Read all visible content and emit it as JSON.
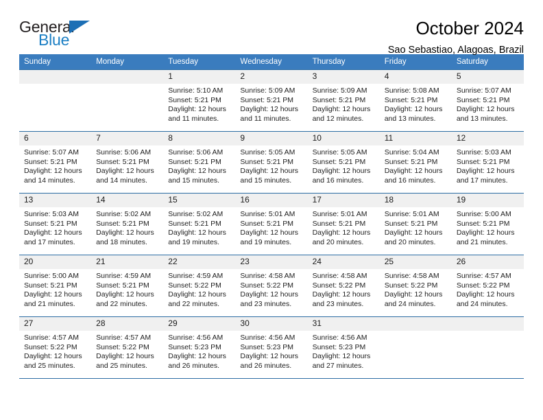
{
  "brand": {
    "name_top": "General",
    "name_bottom": "Blue",
    "accent_color": "#1c7fc4",
    "triangle_color": "#1c6fb5"
  },
  "header": {
    "title": "October 2024",
    "subtitle": "Sao Sebastiao, Alagoas, Brazil"
  },
  "theme": {
    "header_row_bg": "#3a7cbe",
    "header_row_text": "#ffffff",
    "daynum_bg": "#f0f0f0",
    "row_border": "#2b6ca3"
  },
  "weekday_headers": [
    "Sunday",
    "Monday",
    "Tuesday",
    "Wednesday",
    "Thursday",
    "Friday",
    "Saturday"
  ],
  "labels": {
    "sunrise_prefix": "Sunrise:",
    "sunset_prefix": "Sunset:",
    "daylight_prefix": "Daylight:"
  },
  "weeks": [
    [
      {
        "day": "",
        "sunrise": "",
        "sunset": "",
        "daylight_1": "",
        "daylight_2": ""
      },
      {
        "day": "",
        "sunrise": "",
        "sunset": "",
        "daylight_1": "",
        "daylight_2": ""
      },
      {
        "day": "1",
        "sunrise": "Sunrise: 5:10 AM",
        "sunset": "Sunset: 5:21 PM",
        "daylight_1": "Daylight: 12 hours",
        "daylight_2": "and 11 minutes."
      },
      {
        "day": "2",
        "sunrise": "Sunrise: 5:09 AM",
        "sunset": "Sunset: 5:21 PM",
        "daylight_1": "Daylight: 12 hours",
        "daylight_2": "and 11 minutes."
      },
      {
        "day": "3",
        "sunrise": "Sunrise: 5:09 AM",
        "sunset": "Sunset: 5:21 PM",
        "daylight_1": "Daylight: 12 hours",
        "daylight_2": "and 12 minutes."
      },
      {
        "day": "4",
        "sunrise": "Sunrise: 5:08 AM",
        "sunset": "Sunset: 5:21 PM",
        "daylight_1": "Daylight: 12 hours",
        "daylight_2": "and 13 minutes."
      },
      {
        "day": "5",
        "sunrise": "Sunrise: 5:07 AM",
        "sunset": "Sunset: 5:21 PM",
        "daylight_1": "Daylight: 12 hours",
        "daylight_2": "and 13 minutes."
      }
    ],
    [
      {
        "day": "6",
        "sunrise": "Sunrise: 5:07 AM",
        "sunset": "Sunset: 5:21 PM",
        "daylight_1": "Daylight: 12 hours",
        "daylight_2": "and 14 minutes."
      },
      {
        "day": "7",
        "sunrise": "Sunrise: 5:06 AM",
        "sunset": "Sunset: 5:21 PM",
        "daylight_1": "Daylight: 12 hours",
        "daylight_2": "and 14 minutes."
      },
      {
        "day": "8",
        "sunrise": "Sunrise: 5:06 AM",
        "sunset": "Sunset: 5:21 PM",
        "daylight_1": "Daylight: 12 hours",
        "daylight_2": "and 15 minutes."
      },
      {
        "day": "9",
        "sunrise": "Sunrise: 5:05 AM",
        "sunset": "Sunset: 5:21 PM",
        "daylight_1": "Daylight: 12 hours",
        "daylight_2": "and 15 minutes."
      },
      {
        "day": "10",
        "sunrise": "Sunrise: 5:05 AM",
        "sunset": "Sunset: 5:21 PM",
        "daylight_1": "Daylight: 12 hours",
        "daylight_2": "and 16 minutes."
      },
      {
        "day": "11",
        "sunrise": "Sunrise: 5:04 AM",
        "sunset": "Sunset: 5:21 PM",
        "daylight_1": "Daylight: 12 hours",
        "daylight_2": "and 16 minutes."
      },
      {
        "day": "12",
        "sunrise": "Sunrise: 5:03 AM",
        "sunset": "Sunset: 5:21 PM",
        "daylight_1": "Daylight: 12 hours",
        "daylight_2": "and 17 minutes."
      }
    ],
    [
      {
        "day": "13",
        "sunrise": "Sunrise: 5:03 AM",
        "sunset": "Sunset: 5:21 PM",
        "daylight_1": "Daylight: 12 hours",
        "daylight_2": "and 17 minutes."
      },
      {
        "day": "14",
        "sunrise": "Sunrise: 5:02 AM",
        "sunset": "Sunset: 5:21 PM",
        "daylight_1": "Daylight: 12 hours",
        "daylight_2": "and 18 minutes."
      },
      {
        "day": "15",
        "sunrise": "Sunrise: 5:02 AM",
        "sunset": "Sunset: 5:21 PM",
        "daylight_1": "Daylight: 12 hours",
        "daylight_2": "and 19 minutes."
      },
      {
        "day": "16",
        "sunrise": "Sunrise: 5:01 AM",
        "sunset": "Sunset: 5:21 PM",
        "daylight_1": "Daylight: 12 hours",
        "daylight_2": "and 19 minutes."
      },
      {
        "day": "17",
        "sunrise": "Sunrise: 5:01 AM",
        "sunset": "Sunset: 5:21 PM",
        "daylight_1": "Daylight: 12 hours",
        "daylight_2": "and 20 minutes."
      },
      {
        "day": "18",
        "sunrise": "Sunrise: 5:01 AM",
        "sunset": "Sunset: 5:21 PM",
        "daylight_1": "Daylight: 12 hours",
        "daylight_2": "and 20 minutes."
      },
      {
        "day": "19",
        "sunrise": "Sunrise: 5:00 AM",
        "sunset": "Sunset: 5:21 PM",
        "daylight_1": "Daylight: 12 hours",
        "daylight_2": "and 21 minutes."
      }
    ],
    [
      {
        "day": "20",
        "sunrise": "Sunrise: 5:00 AM",
        "sunset": "Sunset: 5:21 PM",
        "daylight_1": "Daylight: 12 hours",
        "daylight_2": "and 21 minutes."
      },
      {
        "day": "21",
        "sunrise": "Sunrise: 4:59 AM",
        "sunset": "Sunset: 5:21 PM",
        "daylight_1": "Daylight: 12 hours",
        "daylight_2": "and 22 minutes."
      },
      {
        "day": "22",
        "sunrise": "Sunrise: 4:59 AM",
        "sunset": "Sunset: 5:22 PM",
        "daylight_1": "Daylight: 12 hours",
        "daylight_2": "and 22 minutes."
      },
      {
        "day": "23",
        "sunrise": "Sunrise: 4:58 AM",
        "sunset": "Sunset: 5:22 PM",
        "daylight_1": "Daylight: 12 hours",
        "daylight_2": "and 23 minutes."
      },
      {
        "day": "24",
        "sunrise": "Sunrise: 4:58 AM",
        "sunset": "Sunset: 5:22 PM",
        "daylight_1": "Daylight: 12 hours",
        "daylight_2": "and 23 minutes."
      },
      {
        "day": "25",
        "sunrise": "Sunrise: 4:58 AM",
        "sunset": "Sunset: 5:22 PM",
        "daylight_1": "Daylight: 12 hours",
        "daylight_2": "and 24 minutes."
      },
      {
        "day": "26",
        "sunrise": "Sunrise: 4:57 AM",
        "sunset": "Sunset: 5:22 PM",
        "daylight_1": "Daylight: 12 hours",
        "daylight_2": "and 24 minutes."
      }
    ],
    [
      {
        "day": "27",
        "sunrise": "Sunrise: 4:57 AM",
        "sunset": "Sunset: 5:22 PM",
        "daylight_1": "Daylight: 12 hours",
        "daylight_2": "and 25 minutes."
      },
      {
        "day": "28",
        "sunrise": "Sunrise: 4:57 AM",
        "sunset": "Sunset: 5:22 PM",
        "daylight_1": "Daylight: 12 hours",
        "daylight_2": "and 25 minutes."
      },
      {
        "day": "29",
        "sunrise": "Sunrise: 4:56 AM",
        "sunset": "Sunset: 5:23 PM",
        "daylight_1": "Daylight: 12 hours",
        "daylight_2": "and 26 minutes."
      },
      {
        "day": "30",
        "sunrise": "Sunrise: 4:56 AM",
        "sunset": "Sunset: 5:23 PM",
        "daylight_1": "Daylight: 12 hours",
        "daylight_2": "and 26 minutes."
      },
      {
        "day": "31",
        "sunrise": "Sunrise: 4:56 AM",
        "sunset": "Sunset: 5:23 PM",
        "daylight_1": "Daylight: 12 hours",
        "daylight_2": "and 27 minutes."
      },
      {
        "day": "",
        "sunrise": "",
        "sunset": "",
        "daylight_1": "",
        "daylight_2": ""
      },
      {
        "day": "",
        "sunrise": "",
        "sunset": "",
        "daylight_1": "",
        "daylight_2": ""
      }
    ]
  ]
}
